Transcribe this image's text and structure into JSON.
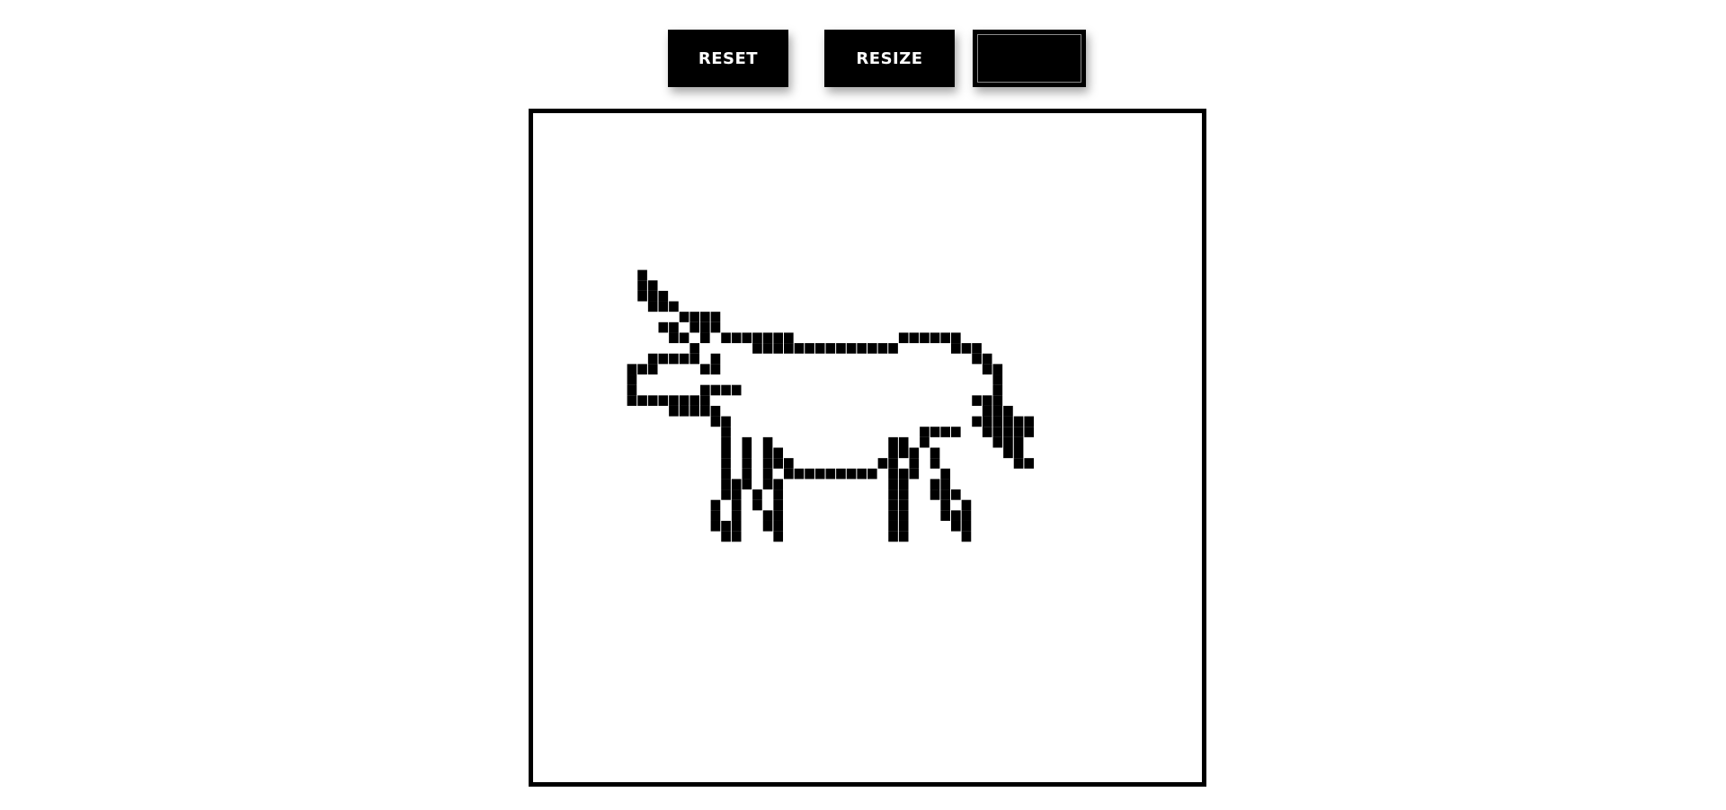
{
  "toolbar": {
    "reset_label": "RESET",
    "resize_label": "RESIZE",
    "color_swatch": "#000000"
  },
  "canvas": {
    "background": "#ffffff",
    "ink_color": "#000000",
    "grid_columns": 64,
    "grid_rows": 64,
    "filled_cells": [
      [
        10,
        15
      ],
      [
        10,
        16
      ],
      [
        11,
        16
      ],
      [
        10,
        17
      ],
      [
        11,
        17
      ],
      [
        12,
        17
      ],
      [
        11,
        18
      ],
      [
        12,
        18
      ],
      [
        13,
        18
      ],
      [
        14,
        19
      ],
      [
        15,
        19
      ],
      [
        16,
        19
      ],
      [
        17,
        19
      ],
      [
        12,
        20
      ],
      [
        13,
        20
      ],
      [
        15,
        20
      ],
      [
        16,
        20
      ],
      [
        17,
        20
      ],
      [
        13,
        21
      ],
      [
        14,
        21
      ],
      [
        16,
        21
      ],
      [
        18,
        21
      ],
      [
        19,
        21
      ],
      [
        20,
        21
      ],
      [
        21,
        21
      ],
      [
        22,
        21
      ],
      [
        24,
        21
      ],
      [
        23,
        21
      ],
      [
        24,
        21
      ],
      [
        35,
        21
      ],
      [
        36,
        21
      ],
      [
        37,
        21
      ],
      [
        38,
        21
      ],
      [
        39,
        21
      ],
      [
        40,
        21
      ],
      [
        15,
        22
      ],
      [
        21,
        22
      ],
      [
        22,
        22
      ],
      [
        23,
        22
      ],
      [
        24,
        22
      ],
      [
        25,
        22
      ],
      [
        26,
        22
      ],
      [
        27,
        22
      ],
      [
        28,
        22
      ],
      [
        29,
        22
      ],
      [
        30,
        22
      ],
      [
        31,
        22
      ],
      [
        32,
        22
      ],
      [
        33,
        22
      ],
      [
        34,
        22
      ],
      [
        40,
        22
      ],
      [
        41,
        22
      ],
      [
        42,
        22
      ],
      [
        11,
        23
      ],
      [
        12,
        23
      ],
      [
        13,
        23
      ],
      [
        14,
        23
      ],
      [
        15,
        23
      ],
      [
        17,
        23
      ],
      [
        42,
        23
      ],
      [
        43,
        23
      ],
      [
        9,
        24
      ],
      [
        10,
        24
      ],
      [
        11,
        24
      ],
      [
        16,
        24
      ],
      [
        17,
        24
      ],
      [
        43,
        24
      ],
      [
        44,
        24
      ],
      [
        9,
        25
      ],
      [
        44,
        25
      ],
      [
        9,
        26
      ],
      [
        16,
        26
      ],
      [
        17,
        26
      ],
      [
        18,
        26
      ],
      [
        19,
        26
      ],
      [
        44,
        26
      ],
      [
        9,
        27
      ],
      [
        10,
        27
      ],
      [
        11,
        27
      ],
      [
        12,
        27
      ],
      [
        13,
        27
      ],
      [
        14,
        27
      ],
      [
        15,
        27
      ],
      [
        16,
        27
      ],
      [
        42,
        27
      ],
      [
        43,
        27
      ],
      [
        44,
        27
      ],
      [
        13,
        28
      ],
      [
        14,
        28
      ],
      [
        15,
        28
      ],
      [
        16,
        28
      ],
      [
        17,
        28
      ],
      [
        43,
        28
      ],
      [
        44,
        28
      ],
      [
        45,
        28
      ],
      [
        17,
        29
      ],
      [
        18,
        29
      ],
      [
        42,
        29
      ],
      [
        43,
        29
      ],
      [
        44,
        29
      ],
      [
        45,
        29
      ],
      [
        46,
        29
      ],
      [
        47,
        29
      ],
      [
        18,
        30
      ],
      [
        37,
        30
      ],
      [
        38,
        30
      ],
      [
        39,
        30
      ],
      [
        40,
        30
      ],
      [
        43,
        30
      ],
      [
        44,
        30
      ],
      [
        45,
        30
      ],
      [
        46,
        30
      ],
      [
        47,
        30
      ],
      [
        18,
        31
      ],
      [
        20,
        31
      ],
      [
        22,
        31
      ],
      [
        34,
        31
      ],
      [
        35,
        31
      ],
      [
        37,
        31
      ],
      [
        44,
        31
      ],
      [
        45,
        31
      ],
      [
        46,
        31
      ],
      [
        18,
        32
      ],
      [
        20,
        32
      ],
      [
        22,
        32
      ],
      [
        23,
        32
      ],
      [
        34,
        32
      ],
      [
        35,
        32
      ],
      [
        36,
        32
      ],
      [
        38,
        32
      ],
      [
        45,
        32
      ],
      [
        46,
        32
      ],
      [
        18,
        33
      ],
      [
        20,
        33
      ],
      [
        22,
        33
      ],
      [
        23,
        33
      ],
      [
        24,
        33
      ],
      [
        33,
        33
      ],
      [
        34,
        33
      ],
      [
        36,
        33
      ],
      [
        38,
        33
      ],
      [
        46,
        33
      ],
      [
        47,
        33
      ],
      [
        18,
        34
      ],
      [
        20,
        34
      ],
      [
        22,
        34
      ],
      [
        24,
        34
      ],
      [
        25,
        34
      ],
      [
        26,
        34
      ],
      [
        27,
        34
      ],
      [
        28,
        34
      ],
      [
        29,
        34
      ],
      [
        30,
        34
      ],
      [
        31,
        34
      ],
      [
        32,
        34
      ],
      [
        34,
        34
      ],
      [
        35,
        34
      ],
      [
        36,
        34
      ],
      [
        39,
        34
      ],
      [
        18,
        35
      ],
      [
        19,
        35
      ],
      [
        20,
        35
      ],
      [
        22,
        35
      ],
      [
        23,
        35
      ],
      [
        34,
        35
      ],
      [
        35,
        35
      ],
      [
        38,
        35
      ],
      [
        39,
        35
      ],
      [
        18,
        36
      ],
      [
        19,
        36
      ],
      [
        21,
        36
      ],
      [
        23,
        36
      ],
      [
        34,
        36
      ],
      [
        35,
        36
      ],
      [
        38,
        36
      ],
      [
        39,
        36
      ],
      [
        40,
        36
      ],
      [
        17,
        37
      ],
      [
        19,
        37
      ],
      [
        21,
        37
      ],
      [
        23,
        37
      ],
      [
        34,
        37
      ],
      [
        35,
        37
      ],
      [
        39,
        37
      ],
      [
        41,
        37
      ],
      [
        17,
        38
      ],
      [
        19,
        38
      ],
      [
        22,
        38
      ],
      [
        23,
        38
      ],
      [
        34,
        38
      ],
      [
        35,
        38
      ],
      [
        39,
        38
      ],
      [
        40,
        38
      ],
      [
        41,
        38
      ],
      [
        17,
        39
      ],
      [
        18,
        39
      ],
      [
        19,
        39
      ],
      [
        22,
        39
      ],
      [
        23,
        39
      ],
      [
        34,
        39
      ],
      [
        35,
        39
      ],
      [
        40,
        39
      ],
      [
        41,
        39
      ],
      [
        18,
        40
      ],
      [
        19,
        40
      ],
      [
        23,
        40
      ],
      [
        34,
        40
      ],
      [
        35,
        40
      ],
      [
        41,
        40
      ]
    ]
  }
}
